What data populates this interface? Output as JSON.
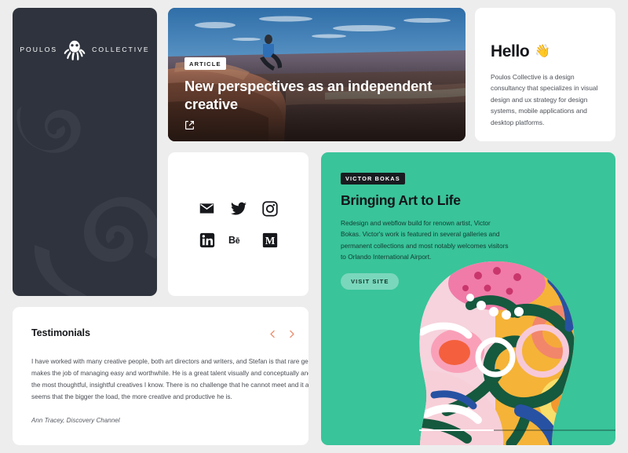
{
  "theme": {
    "page_bg": "#ededed",
    "sidebar_bg": "#2e333d",
    "accent_green": "#39c49a",
    "accent_orange": "#ef8a6a",
    "dark_text": "#14161a"
  },
  "sidebar": {
    "brand_left": "POULOS",
    "brand_right": "COLLECTIVE",
    "logo_icon": "octopus-logo-icon",
    "watermark_icon": "octopus-tentacles-watermark-icon"
  },
  "hero": {
    "badge": "ARTICLE",
    "title": "New perspectives as an independent creative",
    "link_icon": "external-link-icon",
    "image_alt": "person sitting on canyon rock ledge overlooking desert river valley"
  },
  "hello": {
    "title": "Hello",
    "emoji": "👋",
    "body": "Poulos Collective is a design consultancy that specializes in visual design and ux strategy for design systems, mobile applications and desktop platforms."
  },
  "social": {
    "items": [
      {
        "name": "email",
        "icon": "email-icon",
        "label": "Email"
      },
      {
        "name": "twitter",
        "icon": "twitter-icon",
        "label": "Twitter"
      },
      {
        "name": "instagram",
        "icon": "instagram-icon",
        "label": "Instagram"
      },
      {
        "name": "linkedin",
        "icon": "linkedin-icon",
        "label": "LinkedIn"
      },
      {
        "name": "behance",
        "icon": "behance-icon",
        "label": "Be"
      },
      {
        "name": "medium",
        "icon": "medium-icon",
        "label": "M"
      }
    ]
  },
  "project": {
    "badge": "VICTOR BOKAS",
    "title": "Bringing Art to Life",
    "body": "Redesign and webflow build for renown artist, Victor Bokas. Victor's work is featured in several galleries and permanent collections and most notably welcomes visitors to Orlando International Airport.",
    "button": "VISIT SITE",
    "artwork_alt": "colorful abstract painted profile of a head",
    "progress_percent": 38
  },
  "testimonials": {
    "title": "Testimonials",
    "prev_icon": "chevron-left-icon",
    "next_icon": "chevron-right-icon",
    "quote": "I have worked with many creative people, both art directors and writers, and Stefan is that rare gem that makes the job of managing easy and worthwhile. He is a great talent visually and conceptually and is one of the most thoughtful, insightful creatives I know. There is no challenge that he cannot meet and it always seems that the bigger the load, the more creative and productive he is.",
    "author": "Ann Tracey, Discovery Channel"
  }
}
